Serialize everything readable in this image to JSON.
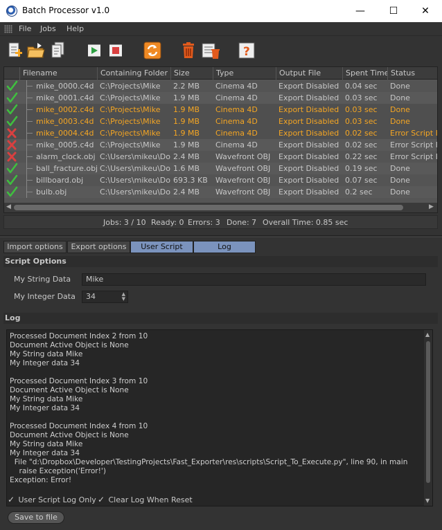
{
  "window": {
    "title": "Batch Processor v1.0",
    "minimize": "—",
    "maximize": "☐",
    "close": "✕"
  },
  "menu": [
    "File",
    "Jobs",
    "Help"
  ],
  "table": {
    "columns": [
      "Filename",
      "Containing Folder",
      "Size",
      "Type",
      "Output File",
      "Spent Time",
      "Status"
    ],
    "rows": [
      {
        "ok": true,
        "sel": false,
        "cells": [
          "mike_0000.c4d",
          "C:\\Projects\\Mike",
          "2.2 MB",
          "Cinema 4D",
          "Export Disabled",
          "0.04 sec",
          "Done"
        ]
      },
      {
        "ok": true,
        "sel": false,
        "cells": [
          "mike_0001.c4d",
          "C:\\Projects\\Mike",
          "1.9 MB",
          "Cinema 4D",
          "Export Disabled",
          "0.03 sec",
          "Done"
        ]
      },
      {
        "ok": true,
        "sel": true,
        "cells": [
          "mike_0002.c4d",
          "C:\\Projects\\Mike",
          "1.9 MB",
          "Cinema 4D",
          "Export Disabled",
          "0.03 sec",
          "Done"
        ]
      },
      {
        "ok": true,
        "sel": true,
        "cells": [
          "mike_0003.c4d",
          "C:\\Projects\\Mike",
          "1.9 MB",
          "Cinema 4D",
          "Export Disabled",
          "0.03 sec",
          "Done"
        ]
      },
      {
        "ok": false,
        "sel": true,
        "cells": [
          "mike_0004.c4d",
          "C:\\Projects\\Mike",
          "1.9 MB",
          "Cinema 4D",
          "Export Disabled",
          "0.02 sec",
          "Error Script Ex"
        ]
      },
      {
        "ok": false,
        "sel": false,
        "cells": [
          "mike_0005.c4d",
          "C:\\Projects\\Mike",
          "1.9 MB",
          "Cinema 4D",
          "Export Disabled",
          "0.02 sec",
          "Error Script Ex"
        ]
      },
      {
        "ok": false,
        "sel": false,
        "cells": [
          "alarm_clock.obj",
          "C:\\Users\\mikeu\\Doc",
          "2.4 MB",
          "Wavefront OBJ",
          "Export Disabled",
          "0.22 sec",
          "Error Script Ex"
        ]
      },
      {
        "ok": true,
        "sel": false,
        "cells": [
          "ball_fracture.obj",
          "C:\\Users\\mikeu\\Doc",
          "1.6 MB",
          "Wavefront OBJ",
          "Export Disabled",
          "0.19 sec",
          "Done"
        ]
      },
      {
        "ok": true,
        "sel": false,
        "cells": [
          "billboard.obj",
          "C:\\Users\\mikeu\\Doc",
          "693.3 KB",
          "Wavefront OBJ",
          "Export Disabled",
          "0.07 sec",
          "Done"
        ]
      },
      {
        "ok": true,
        "sel": false,
        "cells": [
          "bulb.obj",
          "C:\\Users\\mikeu\\Doc",
          "2.4 MB",
          "Wavefront OBJ",
          "Export Disabled",
          "0.2 sec",
          "Done"
        ]
      }
    ]
  },
  "status": {
    "jobs": "Jobs: 3 / 10",
    "ready": "Ready: 0",
    "errors": "Errors: 3",
    "done": "Done: 7",
    "overall": "Overall Time: 0.85 sec"
  },
  "tabs": [
    "Import options",
    "Export options",
    "User Script",
    "Log"
  ],
  "script_options": {
    "header": "Script Options",
    "string_label": "My String Data",
    "string_value": "Mike",
    "integer_label": "My Integer Data",
    "integer_value": "34"
  },
  "log": {
    "header": "Log",
    "text": "Processed Document Index 2 from 10\nDocument Active Object is None\nMy String data Mike\nMy Integer data 34\n\nProcessed Document Index 3 from 10\nDocument Active Object is None\nMy String data Mike\nMy Integer data 34\n\nProcessed Document Index 4 from 10\nDocument Active Object is None\nMy String data Mike\nMy Integer data 34\n  File \"d:\\Dropbox\\Developer\\TestingProjects\\Fast_Exporter\\res\\scripts\\Script_To_Execute.py\", line 90, in main\n    raise Exception('Error!')\nException: Error!"
  },
  "options": {
    "user_script_log_only": "User Script Log Only",
    "clear_log_when_reset": "Clear Log When Reset",
    "save_to_file": "Save to file"
  },
  "colors": {
    "accent_tab": "#7b93bd",
    "selected_text": "#f5a623",
    "ok": "#3fbf3f",
    "error": "#d94040"
  }
}
